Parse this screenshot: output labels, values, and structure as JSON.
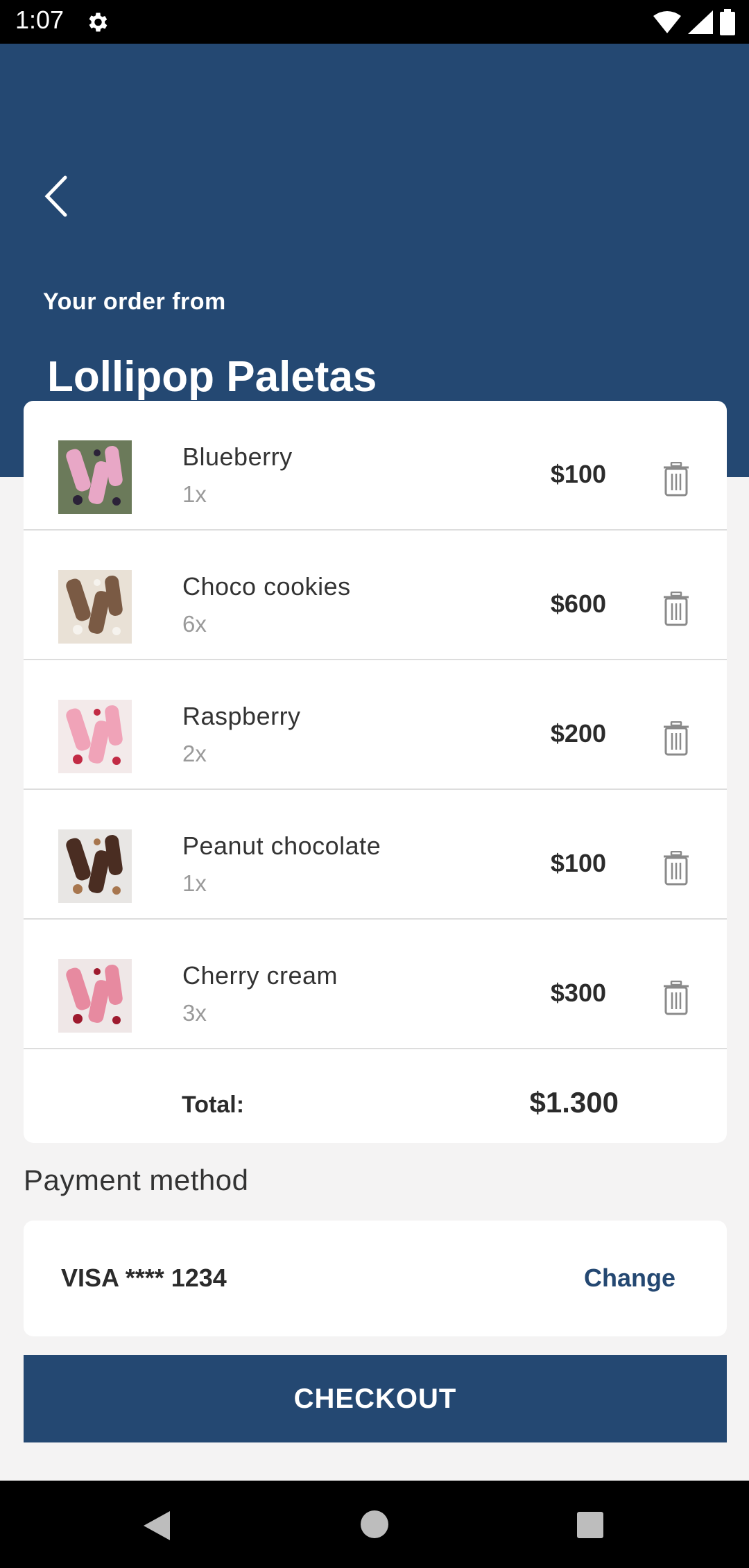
{
  "status_bar": {
    "time": "1:07",
    "icons": [
      "gear-icon",
      "wifi-icon",
      "signal-icon",
      "battery-icon"
    ]
  },
  "header": {
    "back_icon": "chevron-left-icon",
    "subtitle": "Your order from",
    "shop_name": "Lollipop Paletas",
    "background_color": "#244872"
  },
  "cart": {
    "items": [
      {
        "name": "Blueberry",
        "quantity": "1x",
        "price": "$100",
        "thumb_colors": [
          "#6b7a5a",
          "#e8a7c6",
          "#2b2238"
        ]
      },
      {
        "name": "Choco cookies",
        "quantity": "6x",
        "price": "$600",
        "thumb_colors": [
          "#e9e1d6",
          "#7a5a44",
          "#f6f3ee"
        ]
      },
      {
        "name": "Raspberry",
        "quantity": "2x",
        "price": "$200",
        "thumb_colors": [
          "#f3eaea",
          "#f0a3b8",
          "#c22b45"
        ]
      },
      {
        "name": "Peanut chocolate",
        "quantity": "1x",
        "price": "$100",
        "thumb_colors": [
          "#e8e6e4",
          "#4a2d22",
          "#a7764e"
        ]
      },
      {
        "name": "Cherry cream",
        "quantity": "3x",
        "price": "$300",
        "thumb_colors": [
          "#efe7e7",
          "#e78aa0",
          "#9e1a2e"
        ]
      }
    ],
    "delete_icon": "trash-icon",
    "total_label": "Total:",
    "total_value": "$1.300"
  },
  "payment": {
    "title": "Payment method",
    "card_label": "VISA **** 1234",
    "change_label": "Change"
  },
  "checkout": {
    "label": "CHECKOUT"
  },
  "nav_bar": {
    "icons": [
      "nav-back-icon",
      "nav-home-icon",
      "nav-recents-icon"
    ]
  }
}
